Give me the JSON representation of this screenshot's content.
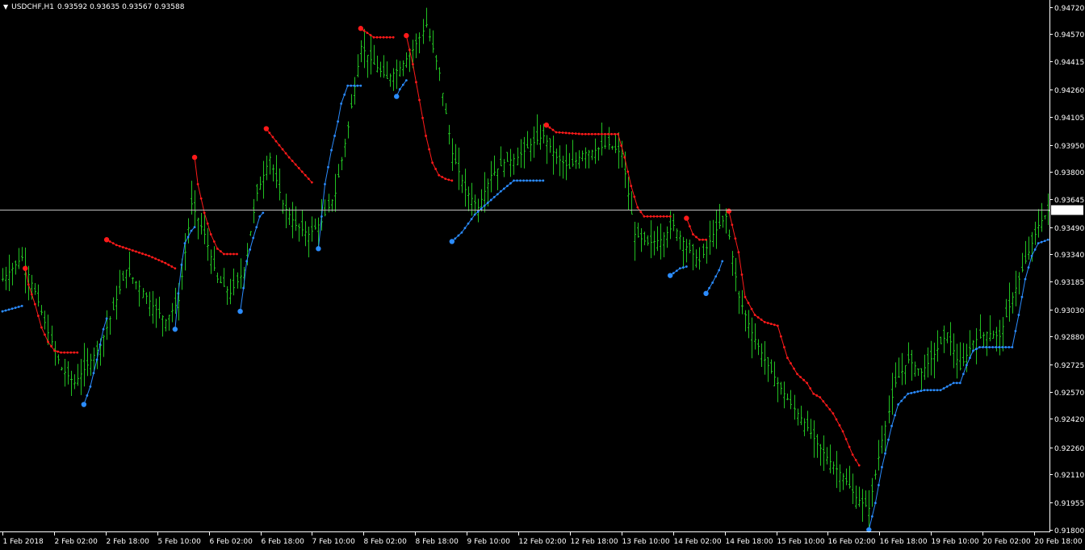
{
  "header": {
    "symbol": "USDCHF,H1",
    "ohlc": "0.93592 0.93635 0.93567 0.93588",
    "menu_icon": "triangle-down-icon"
  },
  "colors": {
    "background": "#000000",
    "axis": "#ffffff",
    "bars": "#22c122",
    "price_line": "#c0c0c0",
    "resistance": "#ff1a1a",
    "support": "#2b8cff",
    "price_box_fill": "#ffffff",
    "price_box_text": "#000000"
  },
  "chart_data": {
    "type": "ohlc",
    "symbol": "USDCHF",
    "timeframe": "H1",
    "y_ticks": [
      "0.94720",
      "0.94570",
      "0.94415",
      "0.94260",
      "0.94105",
      "0.93950",
      "0.93800",
      "0.93645",
      "0.93490",
      "0.93340",
      "0.93185",
      "0.93030",
      "0.92880",
      "0.92725",
      "0.92570",
      "0.92420",
      "0.92260",
      "0.92110",
      "0.91955",
      "0.91800"
    ],
    "ylim": [
      0.918,
      0.94745
    ],
    "x_ticks": [
      "1 Feb 2018",
      "2 Feb 02:00",
      "2 Feb 18:00",
      "5 Feb 10:00",
      "6 Feb 02:00",
      "6 Feb 18:00",
      "7 Feb 10:00",
      "8 Feb 02:00",
      "8 Feb 18:00",
      "9 Feb 10:00",
      "12 Feb 02:00",
      "12 Feb 18:00",
      "13 Feb 10:00",
      "14 Feb 02:00",
      "14 Feb 18:00",
      "15 Feb 10:00",
      "16 Feb 02:00",
      "16 Feb 18:00",
      "19 Feb 10:00",
      "20 Feb 02:00",
      "20 Feb 18:00"
    ],
    "current_price": "0.93588",
    "close_path": [
      [
        0,
        0.932
      ],
      [
        6,
        0.9332
      ],
      [
        10,
        0.9313
      ],
      [
        14,
        0.929
      ],
      [
        18,
        0.927
      ],
      [
        22,
        0.9262
      ],
      [
        26,
        0.9272
      ],
      [
        30,
        0.9283
      ],
      [
        34,
        0.9303
      ],
      [
        38,
        0.9325
      ],
      [
        42,
        0.9316
      ],
      [
        46,
        0.9305
      ],
      [
        50,
        0.9297
      ],
      [
        54,
        0.9308
      ],
      [
        58,
        0.9362
      ],
      [
        62,
        0.9345
      ],
      [
        66,
        0.932
      ],
      [
        70,
        0.9312
      ],
      [
        74,
        0.9325
      ],
      [
        78,
        0.9368
      ],
      [
        82,
        0.9388
      ],
      [
        86,
        0.9362
      ],
      [
        90,
        0.935
      ],
      [
        94,
        0.9345
      ],
      [
        98,
        0.9352
      ],
      [
        102,
        0.9368
      ],
      [
        106,
        0.9405
      ],
      [
        110,
        0.945
      ],
      [
        114,
        0.944
      ],
      [
        118,
        0.9432
      ],
      [
        122,
        0.9438
      ],
      [
        126,
        0.9448
      ],
      [
        130,
        0.9462
      ],
      [
        134,
        0.9435
      ],
      [
        138,
        0.939
      ],
      [
        142,
        0.937
      ],
      [
        146,
        0.936
      ],
      [
        150,
        0.9378
      ],
      [
        154,
        0.9385
      ],
      [
        158,
        0.9388
      ],
      [
        162,
        0.9395
      ],
      [
        166,
        0.94
      ],
      [
        170,
        0.9388
      ],
      [
        174,
        0.9382
      ],
      [
        178,
        0.939
      ],
      [
        182,
        0.9392
      ],
      [
        186,
        0.9395
      ],
      [
        190,
        0.939
      ],
      [
        194,
        0.9345
      ],
      [
        198,
        0.934
      ],
      [
        202,
        0.9342
      ],
      [
        206,
        0.935
      ],
      [
        210,
        0.9338
      ],
      [
        214,
        0.933
      ],
      [
        218,
        0.9345
      ],
      [
        222,
        0.9355
      ],
      [
        226,
        0.931
      ],
      [
        230,
        0.929
      ],
      [
        234,
        0.9275
      ],
      [
        238,
        0.9262
      ],
      [
        242,
        0.925
      ],
      [
        246,
        0.924
      ],
      [
        250,
        0.9228
      ],
      [
        254,
        0.9218
      ],
      [
        258,
        0.921
      ],
      [
        262,
        0.9198
      ],
      [
        266,
        0.9192
      ],
      [
        270,
        0.923
      ],
      [
        274,
        0.9262
      ],
      [
        278,
        0.9275
      ],
      [
        282,
        0.9268
      ],
      [
        286,
        0.9278
      ],
      [
        290,
        0.929
      ],
      [
        294,
        0.927
      ],
      [
        298,
        0.9285
      ],
      [
        302,
        0.929
      ],
      [
        306,
        0.9288
      ],
      [
        310,
        0.931
      ],
      [
        314,
        0.933
      ],
      [
        318,
        0.935
      ],
      [
        321,
        0.9358
      ]
    ],
    "resistance_segments": [
      [
        [
          7,
          0.9326
        ],
        [
          8,
          0.9317
        ],
        [
          10,
          0.9306
        ],
        [
          12,
          0.9293
        ],
        [
          14,
          0.9285
        ],
        [
          16,
          0.928
        ],
        [
          18,
          0.9279
        ],
        [
          23,
          0.9279
        ]
      ],
      [
        [
          32,
          0.9342
        ],
        [
          35,
          0.9339
        ],
        [
          40,
          0.9336
        ],
        [
          45,
          0.9333
        ],
        [
          50,
          0.9329
        ],
        [
          53,
          0.9326
        ]
      ],
      [
        [
          59,
          0.9388
        ],
        [
          60,
          0.9373
        ],
        [
          62,
          0.9357
        ],
        [
          64,
          0.9345
        ],
        [
          66,
          0.9337
        ],
        [
          68,
          0.9334
        ],
        [
          72,
          0.9334
        ]
      ],
      [
        [
          81,
          0.9404
        ],
        [
          84,
          0.9397
        ],
        [
          88,
          0.9388
        ],
        [
          92,
          0.938
        ],
        [
          95,
          0.9374
        ]
      ],
      [
        [
          110,
          0.946
        ],
        [
          114,
          0.9455
        ],
        [
          120,
          0.9455
        ]
      ],
      [
        [
          124,
          0.9456
        ],
        [
          126,
          0.944
        ],
        [
          128,
          0.942
        ],
        [
          130,
          0.94
        ],
        [
          132,
          0.9385
        ],
        [
          134,
          0.9378
        ],
        [
          136,
          0.9376
        ],
        [
          138,
          0.9375
        ]
      ],
      [
        [
          167,
          0.9406
        ],
        [
          170,
          0.9402
        ],
        [
          178,
          0.9401
        ],
        [
          189,
          0.9401
        ],
        [
          191,
          0.9388
        ],
        [
          193,
          0.9372
        ],
        [
          195,
          0.936
        ],
        [
          197,
          0.9355
        ],
        [
          205,
          0.9355
        ]
      ],
      [
        [
          210,
          0.9354
        ],
        [
          212,
          0.9345
        ],
        [
          214,
          0.9342
        ],
        [
          216,
          0.9342
        ]
      ],
      [
        [
          223,
          0.9358
        ],
        [
          226,
          0.9335
        ],
        [
          228,
          0.931
        ],
        [
          231,
          0.93
        ],
        [
          234,
          0.9296
        ],
        [
          238,
          0.9294
        ],
        [
          241,
          0.9276
        ],
        [
          244,
          0.9267
        ],
        [
          247,
          0.9262
        ],
        [
          249,
          0.9256
        ],
        [
          251,
          0.9254
        ],
        [
          255,
          0.9245
        ],
        [
          258,
          0.9235
        ],
        [
          261,
          0.9222
        ],
        [
          263,
          0.9216
        ]
      ]
    ],
    "support_segments": [
      [
        [
          0,
          0.9302
        ],
        [
          6,
          0.9305
        ]
      ],
      [
        [
          25,
          0.925
        ],
        [
          27,
          0.926
        ],
        [
          29,
          0.9275
        ],
        [
          31,
          0.9292
        ],
        [
          32,
          0.9298
        ]
      ],
      [
        [
          53,
          0.9292
        ],
        [
          54,
          0.9312
        ],
        [
          55,
          0.9328
        ],
        [
          56,
          0.934
        ],
        [
          58,
          0.9347
        ],
        [
          59,
          0.9349
        ]
      ],
      [
        [
          73,
          0.9302
        ],
        [
          74,
          0.9315
        ],
        [
          75,
          0.933
        ],
        [
          77,
          0.9343
        ],
        [
          79,
          0.9355
        ],
        [
          80,
          0.9357
        ]
      ],
      [
        [
          97,
          0.9337
        ],
        [
          98,
          0.9355
        ],
        [
          99,
          0.9373
        ],
        [
          101,
          0.9392
        ],
        [
          103,
          0.9408
        ],
        [
          104,
          0.9418
        ],
        [
          106,
          0.9428
        ],
        [
          110,
          0.9428
        ]
      ],
      [
        [
          121,
          0.9422
        ],
        [
          122,
          0.9426
        ],
        [
          124,
          0.9431
        ]
      ],
      [
        [
          138,
          0.9341
        ],
        [
          141,
          0.9346
        ],
        [
          145,
          0.9356
        ],
        [
          148,
          0.9361
        ],
        [
          153,
          0.9369
        ],
        [
          157,
          0.9375
        ],
        [
          166,
          0.9375
        ]
      ],
      [
        [
          205,
          0.9322
        ],
        [
          208,
          0.9326
        ],
        [
          210,
          0.9327
        ]
      ],
      [
        [
          216,
          0.9312
        ],
        [
          218,
          0.9318
        ],
        [
          220,
          0.9325
        ],
        [
          221,
          0.933
        ]
      ],
      [
        [
          266,
          0.918
        ],
        [
          268,
          0.9195
        ],
        [
          270,
          0.9215
        ],
        [
          273,
          0.9238
        ],
        [
          275,
          0.925
        ],
        [
          278,
          0.9256
        ],
        [
          283,
          0.9258
        ],
        [
          288,
          0.9258
        ],
        [
          292,
          0.9262
        ],
        [
          294,
          0.9262
        ],
        [
          296,
          0.9272
        ],
        [
          298,
          0.928
        ],
        [
          300,
          0.9282
        ],
        [
          310,
          0.9282
        ],
        [
          312,
          0.93
        ],
        [
          314,
          0.932
        ],
        [
          316,
          0.9333
        ],
        [
          318,
          0.934
        ],
        [
          321,
          0.9342
        ]
      ]
    ],
    "resistance_start_markers": [
      [
        7,
        0.9326
      ],
      [
        32,
        0.9342
      ],
      [
        59,
        0.9388
      ],
      [
        81,
        0.9404
      ],
      [
        110,
        0.946
      ],
      [
        124,
        0.9456
      ],
      [
        167,
        0.9406
      ],
      [
        210,
        0.9354
      ],
      [
        223,
        0.9358
      ]
    ],
    "support_start_markers": [
      [
        25,
        0.925
      ],
      [
        53,
        0.9292
      ],
      [
        73,
        0.9302
      ],
      [
        97,
        0.9337
      ],
      [
        121,
        0.9422
      ],
      [
        138,
        0.9341
      ],
      [
        205,
        0.9322
      ],
      [
        216,
        0.9312
      ],
      [
        266,
        0.918
      ]
    ]
  }
}
